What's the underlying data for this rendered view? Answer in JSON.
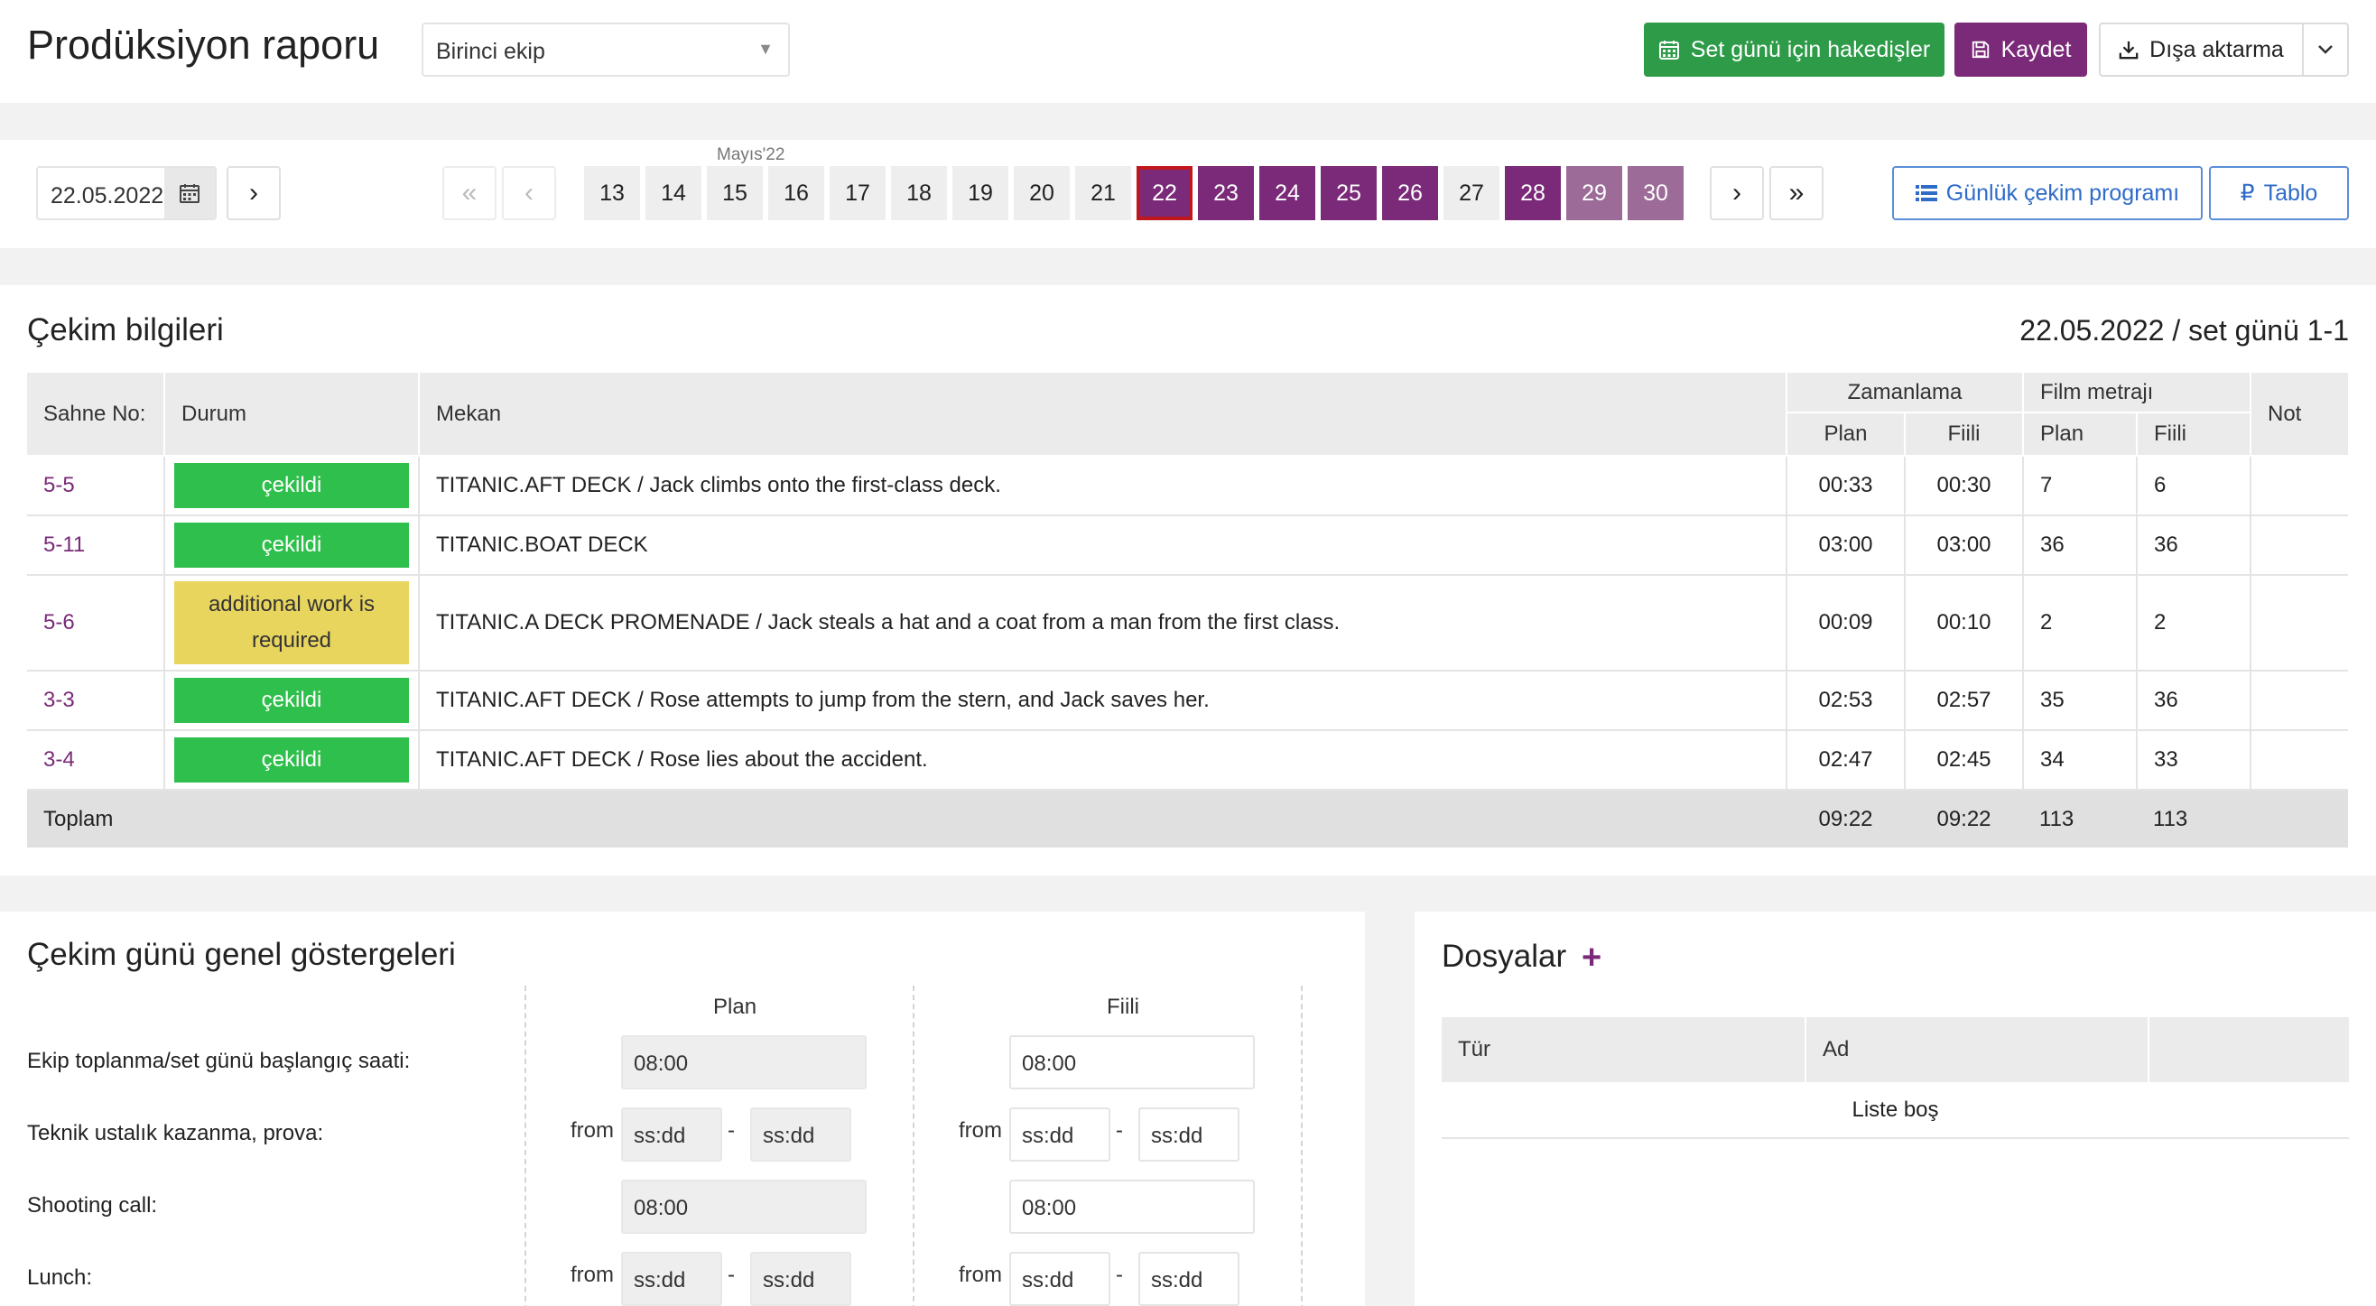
{
  "header": {
    "title": "Prodüksiyon raporu",
    "crew_select": "Birinci ekip",
    "btn_payments": "Set günü için hakedişler",
    "btn_save": "Kaydet",
    "btn_export": "Dışa aktarma"
  },
  "datebar": {
    "date_value": "22.05.2022",
    "month_label": "Mayıs'22",
    "days": [
      "13",
      "14",
      "15",
      "16",
      "17",
      "18",
      "19",
      "20",
      "21",
      "22",
      "23",
      "24",
      "25",
      "26",
      "27",
      "28",
      "29",
      "30"
    ],
    "btn_daily_schedule": "Günlük çekim programı",
    "btn_table": "Tablo"
  },
  "shooting": {
    "title": "Çekim bilgileri",
    "set_day": "22.05.2022 / set günü 1-1",
    "headers": {
      "scene_no": "Sahne No:",
      "status": "Durum",
      "location": "Mekan",
      "timing": "Zamanlama",
      "footage": "Film metrajı",
      "note": "Not",
      "plan": "Plan",
      "actual": "Fiili"
    },
    "rows": [
      {
        "scene": "5-5",
        "status": "çekildi",
        "location": "TITANIC.AFT DECK / Jack climbs onto the first-class deck.",
        "t_plan": "00:33",
        "t_actual": "00:30",
        "f_plan": "7",
        "f_actual": "6",
        "note": ""
      },
      {
        "scene": "5-11",
        "status": "çekildi",
        "location": "TITANIC.BOAT DECK",
        "t_plan": "03:00",
        "t_actual": "03:00",
        "f_plan": "36",
        "f_actual": "36",
        "note": ""
      },
      {
        "scene": "5-6",
        "status": "additional work is required",
        "location": "TITANIC.A DECK PROMENADE / Jack steals a hat and a coat from a man from the first class.",
        "t_plan": "00:09",
        "t_actual": "00:10",
        "f_plan": "2",
        "f_actual": "2",
        "note": ""
      },
      {
        "scene": "3-3",
        "status": "çekildi",
        "location": "TITANIC.AFT DECK / Rose attempts to jump from the stern, and Jack saves her.",
        "t_plan": "02:53",
        "t_actual": "02:57",
        "f_plan": "35",
        "f_actual": "36",
        "note": ""
      },
      {
        "scene": "3-4",
        "status": "çekildi",
        "location": "TITANIC.AFT DECK / Rose lies about the accident.",
        "t_plan": "02:47",
        "t_actual": "02:45",
        "f_plan": "34",
        "f_actual": "33",
        "note": ""
      }
    ],
    "total": {
      "label": "Toplam",
      "t_plan": "09:22",
      "t_actual": "09:22",
      "f_plan": "113",
      "f_actual": "113"
    }
  },
  "indicators": {
    "title": "Çekim günü genel göstergeleri",
    "col_plan": "Plan",
    "col_actual": "Fiili",
    "from_label": "from",
    "dash": "-",
    "rows": {
      "crew_start": {
        "label": "Ekip toplanma/set günü başlangıç saati:",
        "plan": "08:00",
        "actual": "08:00"
      },
      "rehearsal": {
        "label": "Teknik ustalık kazanma, prova:",
        "plan_from": "ss:dd",
        "plan_to": "ss:dd",
        "actual_from": "ss:dd",
        "actual_to": "ss:dd"
      },
      "shooting_call": {
        "label": "Shooting call:",
        "plan": "08:00",
        "actual": "08:00"
      },
      "lunch": {
        "label": "Lunch:",
        "plan_from": "ss:dd",
        "plan_to": "ss:dd",
        "actual_from": "ss:dd",
        "actual_to": "ss:dd"
      }
    }
  },
  "files": {
    "title": "Dosyalar",
    "col_type": "Tür",
    "col_name": "Ad",
    "empty": "Liste boş"
  },
  "colors": {
    "purple": "#7a2a78",
    "purple_light": "#9c6b98",
    "green_btn": "#2e9b48",
    "status_green": "#2fbf4c",
    "status_yellow": "#e8d55e",
    "selected_outline": "#c0171d",
    "link_blue": "#2f6bc8"
  }
}
